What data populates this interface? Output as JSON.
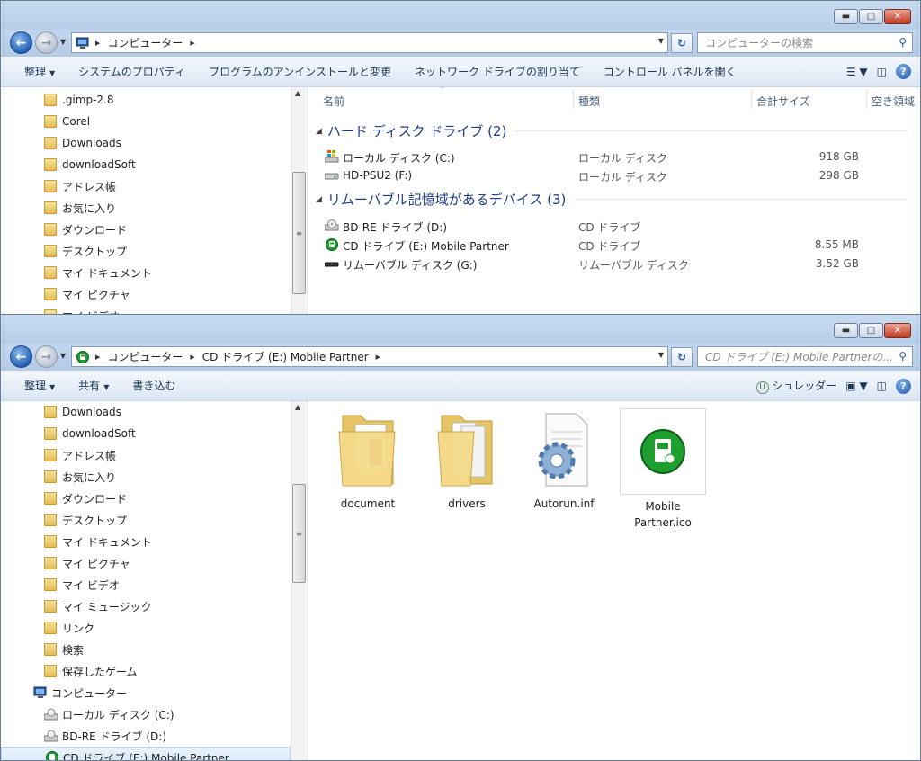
{
  "window1": {
    "breadcrumb": "コンピューター",
    "search_placeholder": "コンピューターの検索",
    "commands": [
      "整理",
      "システムのプロパティ",
      "プログラムのアンインストールと変更",
      "ネットワーク ドライブの割り当て",
      "コントロール パネルを開く"
    ],
    "tree": [
      ".gimp-2.8",
      "Corel",
      "Downloads",
      "downloadSoft",
      "アドレス帳",
      "お気に入り",
      "ダウンロード",
      "デスクトップ",
      "マイ ドキュメント",
      "マイ ピクチャ",
      "マイ ビデオ"
    ],
    "columns": [
      "名前",
      "種類",
      "合計サイズ",
      "空き領域"
    ],
    "groups": [
      {
        "title": "ハード ディスク ドライブ (2)",
        "rows": [
          {
            "name": "ローカル ディスク (C:)",
            "type": "ローカル ディスク",
            "size": "918 GB"
          },
          {
            "name": "HD-PSU2 (F:)",
            "type": "ローカル ディスク",
            "size": "298 GB"
          }
        ]
      },
      {
        "title": "リムーバブル記憶域があるデバイス (3)",
        "rows": [
          {
            "name": "BD-RE ドライブ (D:)",
            "type": "CD ドライブ",
            "size": ""
          },
          {
            "name": "CD ドライブ (E:) Mobile Partner",
            "type": "CD ドライブ",
            "size": "8.55 MB"
          },
          {
            "name": "リムーバブル ディスク (G:)",
            "type": "リムーバブル ディスク",
            "size": "3.52 GB"
          }
        ]
      }
    ]
  },
  "window2": {
    "breadcrumb1": "コンピューター",
    "breadcrumb2": "CD ドライブ (E:) Mobile Partner",
    "search_placeholder": "CD ドライブ (E:) Mobile Partnerの...",
    "commands": [
      "整理",
      "共有",
      "書き込む"
    ],
    "shredder": "シュレッダー",
    "tree": [
      {
        "label": "Downloads",
        "kind": "folder"
      },
      {
        "label": "downloadSoft",
        "kind": "folder"
      },
      {
        "label": "アドレス帳",
        "kind": "folder"
      },
      {
        "label": "お気に入り",
        "kind": "folder"
      },
      {
        "label": "ダウンロード",
        "kind": "folder"
      },
      {
        "label": "デスクトップ",
        "kind": "folder"
      },
      {
        "label": "マイ ドキュメント",
        "kind": "folder"
      },
      {
        "label": "マイ ピクチャ",
        "kind": "folder"
      },
      {
        "label": "マイ ビデオ",
        "kind": "folder"
      },
      {
        "label": "マイ ミュージック",
        "kind": "folder"
      },
      {
        "label": "リンク",
        "kind": "folder"
      },
      {
        "label": "検索",
        "kind": "folder"
      },
      {
        "label": "保存したゲーム",
        "kind": "folder"
      },
      {
        "label": "コンピューター",
        "kind": "computer"
      },
      {
        "label": "ローカル ディスク (C:)",
        "kind": "drive"
      },
      {
        "label": "BD-RE ドライブ (D:)",
        "kind": "drive"
      },
      {
        "label": "CD ドライブ (E:) Mobile Partner",
        "kind": "cd"
      }
    ],
    "files": [
      {
        "name": "document",
        "kind": "folder"
      },
      {
        "name": "drivers",
        "kind": "folder"
      },
      {
        "name": "Autorun.inf",
        "kind": "settings"
      },
      {
        "name": "Mobile Partner.ico",
        "kind": "icon"
      }
    ]
  }
}
